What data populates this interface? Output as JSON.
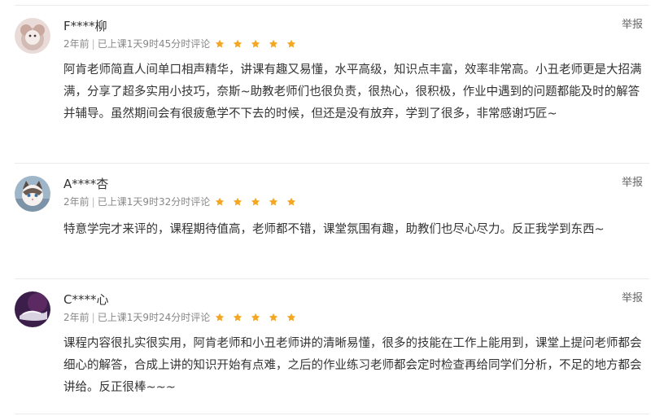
{
  "colors": {
    "star": "#f5a623",
    "text": "#333333",
    "meta": "#888888",
    "divider": "#ebebeb"
  },
  "reviews": [
    {
      "username": "F****柳",
      "time": "2年前",
      "progress": "已上课1天9时45分时评论",
      "rating": 5,
      "report_label": "举报",
      "content": "阿肯老师简直人间单口相声精华，讲课有趣又易懂，水平高级，知识点丰富，效率非常高。小丑老师更是大招满满，分享了超多实用小技巧，奈斯~助教老师们也很负责，很热心，很积极，作业中遇到的问题都能及时的解答并辅导。虽然期间会有很疲惫学不下去的时候，但还是没有放弃，学到了很多，非常感谢巧匠~"
    },
    {
      "username": "A****杏",
      "time": "2年前",
      "progress": "已上课1天9时32分时评论",
      "rating": 5,
      "report_label": "举报",
      "content": "特意学完才来评的，课程期待值高，老师都不错，课堂氛围有趣，助教们也尽心尽力。反正我学到东西~"
    },
    {
      "username": "C****心",
      "time": "2年前",
      "progress": "已上课1天9时24分时评论",
      "rating": 5,
      "report_label": "举报",
      "content": "课程内容很扎实很实用，阿肯老师和小丑老师讲的清晰易懂，很多的技能在工作上能用到，课堂上提问老师都会细心的解答，合成上讲的知识开始有点难，之后的作业练习老师都会定时检查再给同学们分析，不足的地方都会讲给。反正很棒~~~"
    }
  ]
}
